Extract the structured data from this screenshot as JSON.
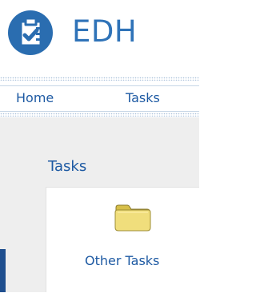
{
  "app": {
    "title": "EDH"
  },
  "nav": {
    "items": [
      {
        "label": "Home"
      },
      {
        "label": "Tasks"
      }
    ]
  },
  "main": {
    "title": "Tasks",
    "tiles": [
      {
        "label": "Other Tasks",
        "icon": "folder-icon"
      }
    ]
  },
  "colors": {
    "brand_blue": "#2f73b8",
    "link_blue": "#1e5aa3",
    "content_bg": "#eeeeee",
    "accent_navy": "#1f4f8f",
    "folder_yellow": "#e9d36d"
  },
  "icons": {
    "logo": "clipboard-check-icon",
    "folder": "folder-icon"
  }
}
